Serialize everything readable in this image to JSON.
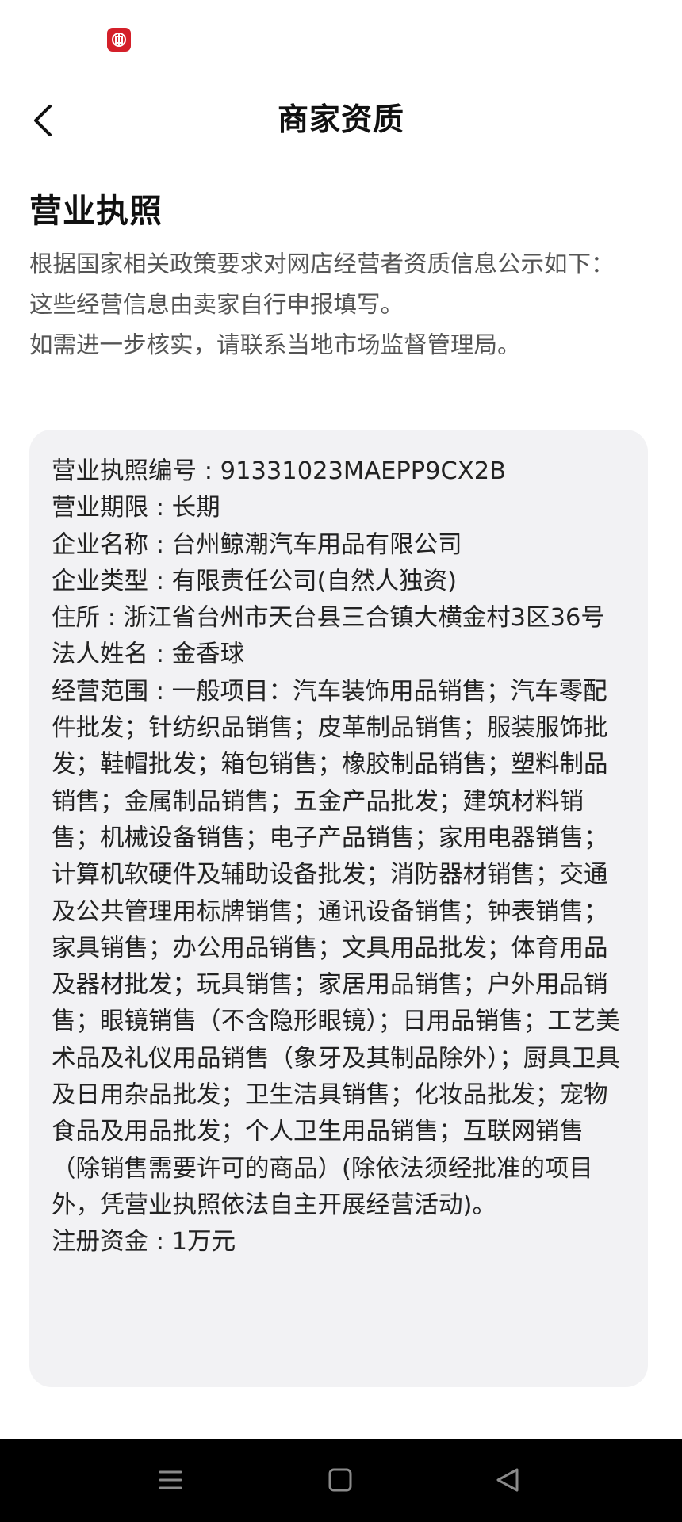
{
  "header": {
    "title": "商家资质"
  },
  "section": {
    "title": "营业执照"
  },
  "notice": {
    "line1": "根据国家相关政策要求对网店经营者资质信息公示如下：",
    "line2": "这些经营信息由卖家自行申报填写。",
    "line3": "如需进一步核实，请联系当地市场监督管理局。"
  },
  "license": {
    "number": "营业执照编号 : 91331023MAEPP9CX2B",
    "term": "营业期限 : 长期",
    "company_name": "企业名称 : 台州鲸潮汽车用品有限公司",
    "company_type": "企业类型 : 有限责任公司(自然人独资)",
    "address": "住所 : 浙江省台州市天台县三合镇大横金村3区36号",
    "legal_person": "法人姓名 : 金香球",
    "business_scope": "经营范围 : 一般项目：汽车装饰用品销售；汽车零配件批发；针纺织品销售；皮革制品销售；服装服饰批发；鞋帽批发；箱包销售；橡胶制品销售；塑料制品销售；金属制品销售；五金产品批发；建筑材料销售；机械设备销售；电子产品销售；家用电器销售；计算机软硬件及辅助设备批发；消防器材销售；交通及公共管理用标牌销售；通讯设备销售；钟表销售；家具销售；办公用品销售；文具用品批发；体育用品及器材批发；玩具销售；家居用品销售；户外用品销售；眼镜销售（不含隐形眼镜）；日用品销售；工艺美术品及礼仪用品销售（象牙及其制品除外）；厨具卫具及日用杂品批发；卫生洁具销售；化妆品批发；宠物食品及用品批发；个人卫生用品销售；互联网销售（除销售需要许可的商品）(除依法须经批准的项目外，凭营业执照依法自主开展经营活动)。",
    "registered_capital": "注册资金 : 1万元"
  },
  "icons": {
    "status_app": "bank-app-icon",
    "back": "chevron-left-icon",
    "nav_menu": "menu-icon",
    "nav_home": "square-home-icon",
    "nav_back": "triangle-back-icon"
  },
  "colors": {
    "status_app_icon": "#d4202a",
    "card_background": "#f2f2f4",
    "nav_bar": "#000000"
  }
}
